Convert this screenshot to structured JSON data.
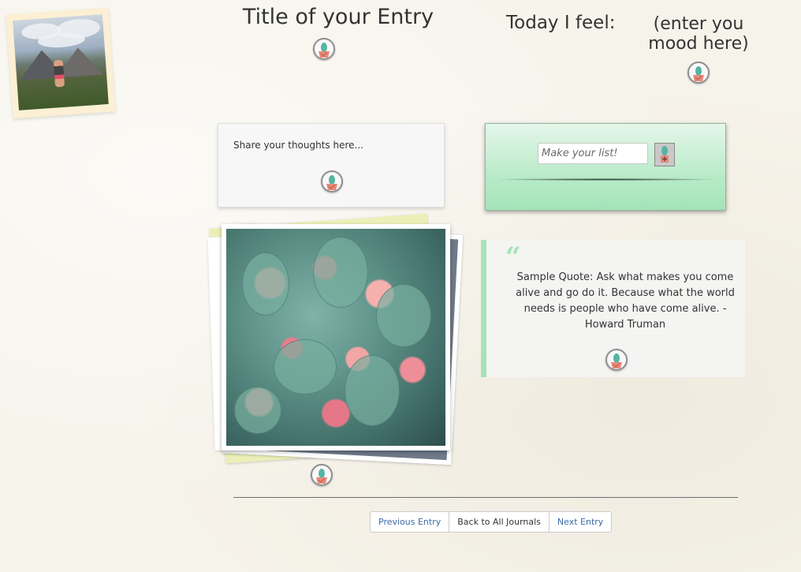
{
  "entry": {
    "title": "Title of your Entry",
    "feel_label": "Today I feel:",
    "mood_placeholder": "(enter you mood here)"
  },
  "thoughts": {
    "placeholder": "Share your thoughts here..."
  },
  "list": {
    "input_placeholder": "Make your list!"
  },
  "quote": {
    "mark": "“",
    "text": "Sample Quote: Ask what makes you come alive and go do it. Because what the world needs is people who have come alive. - Howard Truman"
  },
  "nav": {
    "previous": "Previous Entry",
    "back": "Back to All Journals",
    "next": "Next Entry"
  },
  "colors": {
    "accent_green": "#a6e3b8",
    "link_blue": "#3a6aa8",
    "icon_cactus": "#56b4a3",
    "icon_pot": "#e88a7a"
  },
  "icons": {
    "edit": "cactus-icon",
    "add": "cactus-plus-icon"
  }
}
